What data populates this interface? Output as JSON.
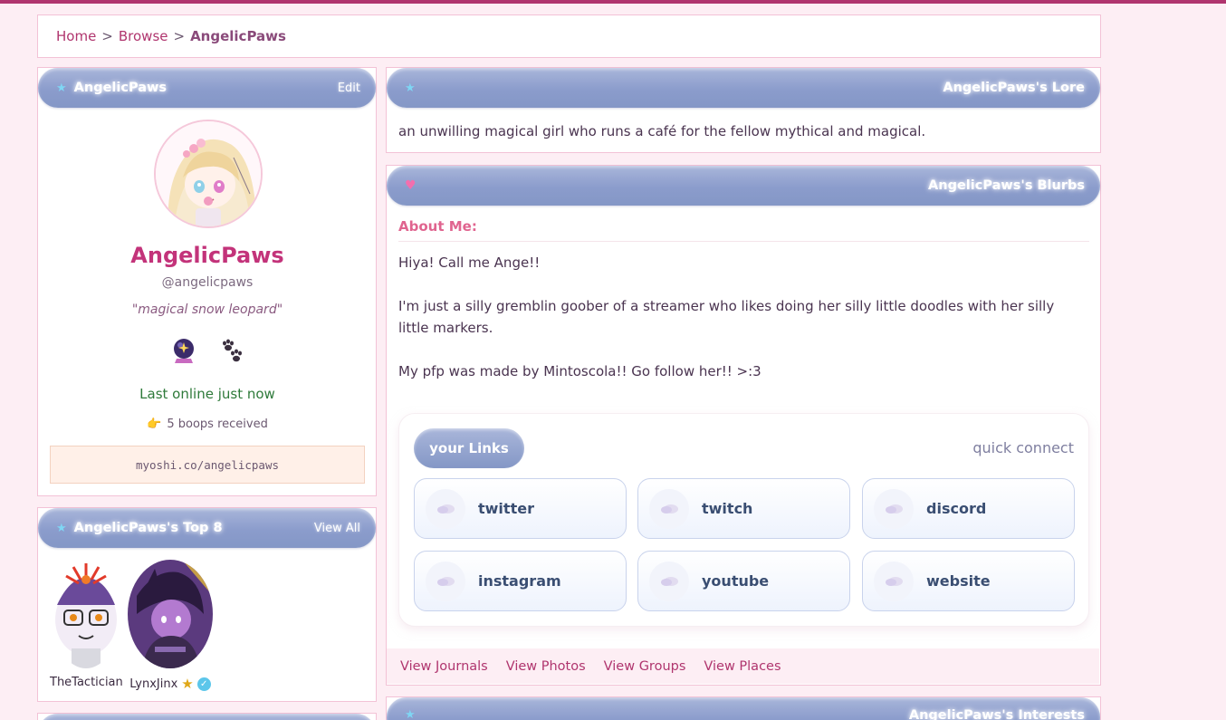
{
  "breadcrumb": {
    "home": "Home",
    "browse": "Browse",
    "current": "AngelicPaws",
    "sep": ">"
  },
  "profile": {
    "header_title": "AngelicPaws",
    "edit_label": "Edit",
    "name": "AngelicPaws",
    "handle": "@angelicpaws",
    "quote": "\"magical snow leopard\"",
    "badges": [
      "crystal-ball-icon",
      "paw-prints-icon"
    ],
    "online_status": "Last online just now",
    "boops": "5 boops received",
    "profile_url": "myoshi.co/angelicpaws"
  },
  "top8": {
    "header_title": "AngelicPaws's Top 8",
    "view_all_label": "View All",
    "friends": [
      {
        "name": "TheTactician"
      },
      {
        "name": "LynxJinx"
      }
    ]
  },
  "lore": {
    "header_title": "AngelicPaws's Lore",
    "text": "an unwilling magical girl who runs a café for the fellow mythical and magical."
  },
  "blurbs": {
    "header_title": "AngelicPaws's Blurbs",
    "about_label": "About Me:",
    "paragraphs": [
      "Hiya! Call me Ange!!",
      "I'm just a silly gremblin goober of a streamer who likes doing her silly little doodles with her silly little markers.",
      "My pfp was made by Mintoscola!! Go follow her!! >:3"
    ],
    "links_title": "your Links",
    "quick_connect": "quick connect",
    "links": [
      "twitter",
      "twitch",
      "discord",
      "instagram",
      "youtube",
      "website"
    ],
    "view_links": [
      "View Journals",
      "View Photos",
      "View Groups",
      "View Places"
    ]
  },
  "interests": {
    "header_title": "AngelicPaws's Interests"
  },
  "colors": {
    "accent": "#b0356e",
    "name_pink": "#c3337a",
    "pill_blue": "#8b9ccc",
    "online_green": "#2e7a3a"
  }
}
